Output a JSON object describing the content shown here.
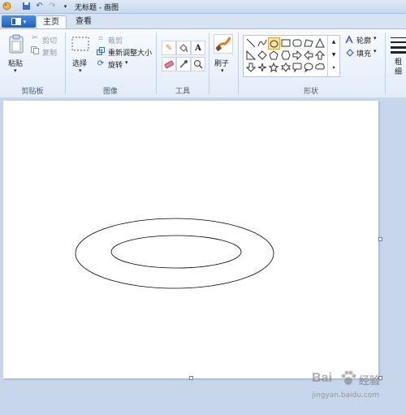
{
  "window": {
    "title": "无标题 - 画图"
  },
  "tabs": [
    {
      "label": "主页"
    },
    {
      "label": "查看"
    }
  ],
  "clipboard": {
    "paste": "粘贴",
    "cut": "剪切",
    "copy": "复制",
    "group": "剪贴板"
  },
  "image": {
    "select": "选择",
    "crop": "裁剪",
    "resize": "重新调整大小",
    "rotate": "旋转",
    "group": "图像"
  },
  "tools": {
    "group": "工具"
  },
  "brushes": {
    "label": "刷子"
  },
  "shapes": {
    "group": "形状",
    "outline": "轮廓",
    "fill": "填充"
  },
  "size": {
    "label": "粗细"
  },
  "watermark": {
    "logo": "Bai",
    "logo2": "经验",
    "url": "jingyan.baidu.com"
  }
}
